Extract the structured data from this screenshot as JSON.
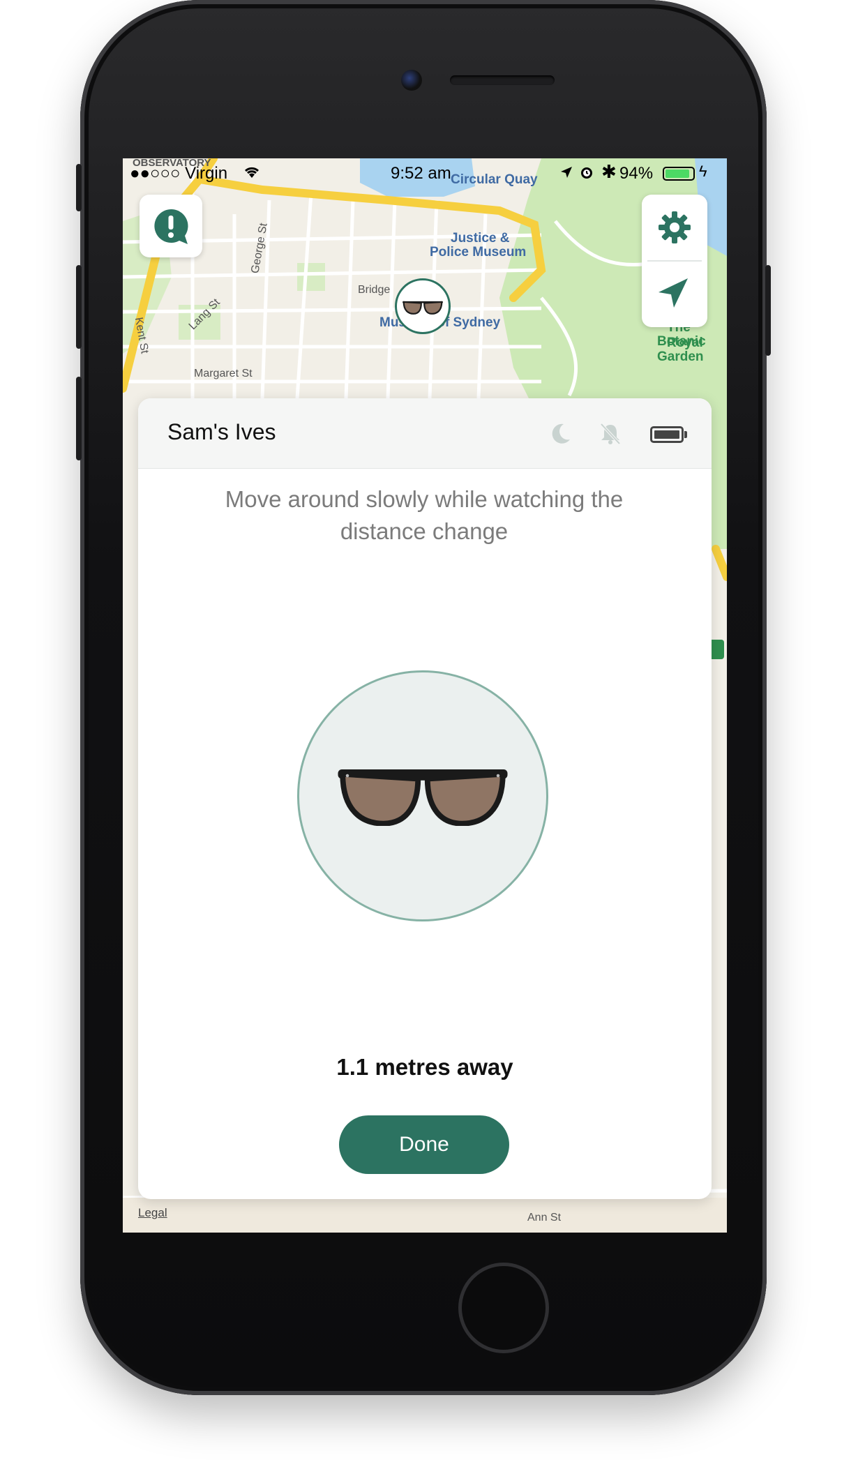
{
  "status_bar": {
    "carrier": "●●○○○ Virgin",
    "time": "9:52 am",
    "battery": "94%"
  },
  "map": {
    "labels": {
      "observatory": "OBSERVATORY",
      "circular_quay": "Circular Quay",
      "justice_museum_1": "Justice &",
      "justice_museum_2": "Police Museum",
      "museum_of_sydney": "Museum of Sydney",
      "george_st": "George St",
      "kent_st": "Kent St",
      "lang_st": "Lang St",
      "margaret_st": "Margaret St",
      "bridge_st": "Bridge",
      "botanic_1": "The Royal",
      "botanic_2": "Botanic Garden",
      "ann_st": "Ann St",
      "legal": "Legal"
    }
  },
  "sheet": {
    "title": "Sam's Ives",
    "instruction": "Move around slowly while watching the distance change",
    "distance": "1.1 metres away",
    "done_label": "Done"
  },
  "icons": {
    "alert": "alert-bubble-icon",
    "settings": "gear-icon",
    "locate": "location-arrow-icon",
    "moon": "moon-icon",
    "bell": "bell-off-icon",
    "battery": "battery-icon",
    "device": "sunglasses-icon"
  },
  "colors": {
    "accent": "#2c7361",
    "circle_fill": "#ebf0ef",
    "circle_border": "#86b2a5",
    "map_road_major": "#f6cf3f",
    "map_water": "#a9d3f0",
    "map_park": "#cde9b6"
  }
}
